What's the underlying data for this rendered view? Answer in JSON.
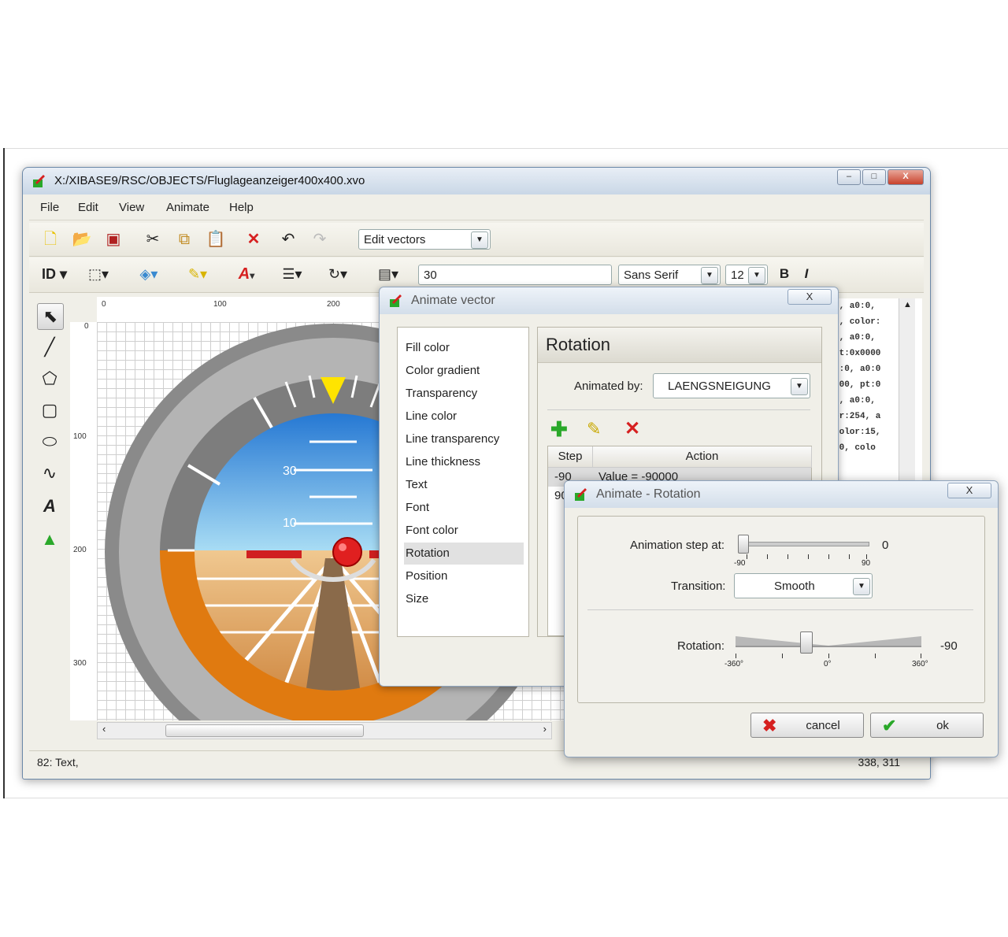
{
  "window": {
    "title": "X:/XIBASE9/RSC/OBJECTS/Fluglageanzeiger400x400.xvo",
    "controls": {
      "minimize": "–",
      "maximize": "□",
      "close": "X"
    }
  },
  "menu": [
    "File",
    "Edit",
    "View",
    "Animate",
    "Help"
  ],
  "toolbar": {
    "mode_select": "Edit vectors",
    "id_label": "ID",
    "value_field": "30",
    "font_family": "Sans Serif",
    "font_size": "12",
    "bold": "B",
    "italic": "I"
  },
  "ruler": {
    "top": [
      "0",
      "100",
      "200"
    ],
    "left": [
      "0",
      "100",
      "200",
      "300"
    ]
  },
  "canvas": {
    "pitch_labels": [
      "30",
      "10"
    ]
  },
  "status": {
    "left": "82: Text,",
    "right": "338, 311"
  },
  "code_lines": [
    "0, a0:0,",
    "0, color:",
    "0, a0:0,",
    "pt:0x0000",
    "r:0, a0:0",
    "000, pt:0",
    "0, a0:0,",
    "or:254, a",
    "color:15,",
    "90, colo"
  ],
  "animate_vector": {
    "title": "Animate vector",
    "close": "X",
    "properties": [
      "Fill color",
      "Color gradient",
      "Transparency",
      "Line color",
      "Line transparency",
      "Line thickness",
      "Text",
      "Font",
      "Font color",
      "Rotation",
      "Position",
      "Size"
    ],
    "selected_property": "Rotation",
    "panel_title": "Rotation",
    "animated_by_label": "Animated by:",
    "animated_by_value": "LAENGSNEIGUNG",
    "table_headers": [
      "Step",
      "Action"
    ],
    "rows": [
      {
        "step": "-90",
        "action": "Value = -90000"
      },
      {
        "step": "90",
        "action": ""
      }
    ]
  },
  "animate_rotation": {
    "title": "Animate - Rotation",
    "close": "X",
    "step_label": "Animation step at:",
    "step_value": "0",
    "step_min": "-90",
    "step_max": "90",
    "step_position": 0.0,
    "transition_label": "Transition:",
    "transition_value": "Smooth",
    "rotation_label": "Rotation:",
    "rotation_value": "-90",
    "rotation_ticks": [
      "-360°",
      "0°",
      "360°"
    ],
    "rotation_position": 0.375,
    "cancel_label": "cancel",
    "ok_label": "ok"
  },
  "colors": {
    "sky": "#2a8fe0",
    "ground": "#e07a10",
    "pointer": "#ffe400",
    "cancel_icon": "#d62020",
    "ok_icon": "#2aa82a"
  }
}
